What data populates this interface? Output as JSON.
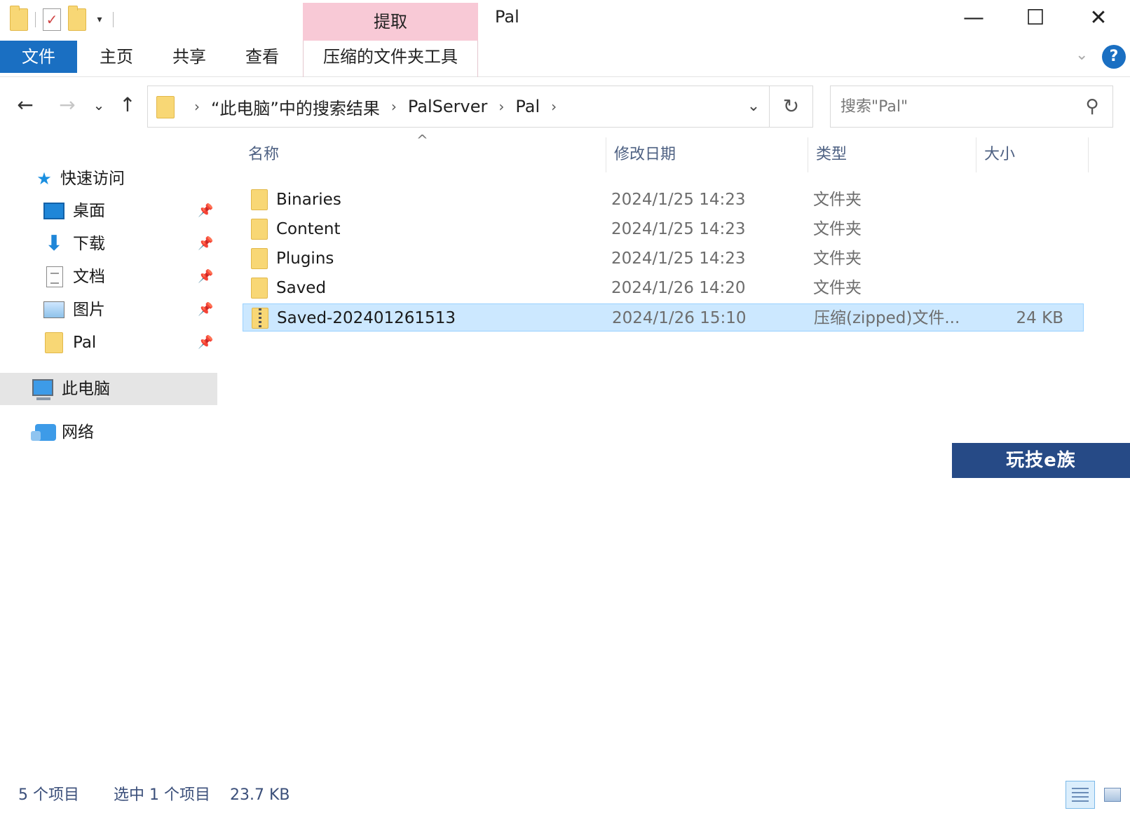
{
  "title_bar": {
    "window_title": "Pal",
    "context_tab_group": "提取",
    "minimize_symbol": "—",
    "maximize_symbol": "☐",
    "close_symbol": "✕"
  },
  "ribbon": {
    "tabs": [
      "文件",
      "主页",
      "共享",
      "查看",
      "压缩的文件夹工具"
    ],
    "file_tab_color": "#1a6fc2",
    "context_tab_color": "#f8c9d6",
    "help_label": "?"
  },
  "navigation": {
    "back_symbol": "←",
    "forward_symbol": "→",
    "recent_symbol": "⌄",
    "up_symbol": "↑",
    "breadcrumb": [
      "“此电脑”中的搜索结果",
      "PalServer",
      "Pal"
    ],
    "breadcrumb_separator": "›",
    "dropdown_symbol": "⌄",
    "refresh_symbol": "↻"
  },
  "search": {
    "placeholder": "搜索\"Pal\"",
    "icon": "search-icon"
  },
  "sidebar": {
    "quick_access": "快速访问",
    "pin_symbol": "📌",
    "pinned_items": [
      {
        "label": "桌面",
        "icon": "desktop-icon"
      },
      {
        "label": "下载",
        "icon": "download-icon"
      },
      {
        "label": "文档",
        "icon": "document-icon"
      },
      {
        "label": "图片",
        "icon": "picture-icon"
      },
      {
        "label": "Pal",
        "icon": "folder-icon"
      }
    ],
    "this_pc": "此电脑",
    "network": "网络"
  },
  "file_list": {
    "columns": {
      "name": "名称",
      "modified": "修改日期",
      "type": "类型",
      "size": "大小"
    },
    "sort_indicator": "^",
    "rows": [
      {
        "name": "Binaries",
        "modified": "2024/1/25 14:23",
        "type": "文件夹",
        "size": "",
        "kind": "folder"
      },
      {
        "name": "Content",
        "modified": "2024/1/25 14:23",
        "type": "文件夹",
        "size": "",
        "kind": "folder"
      },
      {
        "name": "Plugins",
        "modified": "2024/1/25 14:23",
        "type": "文件夹",
        "size": "",
        "kind": "folder"
      },
      {
        "name": "Saved",
        "modified": "2024/1/26 14:20",
        "type": "文件夹",
        "size": "",
        "kind": "folder"
      },
      {
        "name": "Saved-202401261513",
        "modified": "2024/1/26 15:10",
        "type": "压缩(zipped)文件...",
        "size": "24 KB",
        "kind": "zip",
        "selected": true
      }
    ],
    "selection_color": "#cce8ff"
  },
  "watermark": {
    "text": "玩技e族"
  },
  "status_bar": {
    "item_count": "5 个项目",
    "selection": "选中 1 个项目",
    "selection_size": "23.7 KB",
    "active_view": "details"
  }
}
